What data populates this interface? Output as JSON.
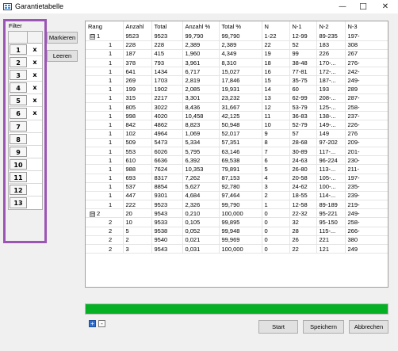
{
  "window": {
    "title": "Garantietabelle",
    "minimize": "—",
    "maximize": "☐",
    "close": "✕"
  },
  "filter": {
    "label": "Filter",
    "rows": [
      {
        "num": "1",
        "mark": "x"
      },
      {
        "num": "2",
        "mark": "x"
      },
      {
        "num": "3",
        "mark": "x"
      },
      {
        "num": "4",
        "mark": "x"
      },
      {
        "num": "5",
        "mark": "x"
      },
      {
        "num": "6",
        "mark": "x"
      },
      {
        "num": "7",
        "mark": ""
      },
      {
        "num": "8",
        "mark": ""
      },
      {
        "num": "9",
        "mark": ""
      },
      {
        "num": "10",
        "mark": ""
      },
      {
        "num": "11",
        "mark": ""
      },
      {
        "num": "12",
        "mark": ""
      },
      {
        "num": "13",
        "mark": ""
      }
    ]
  },
  "buttons": {
    "markieren": "Markieren",
    "leeren": "Leeren",
    "start": "Start",
    "speichern": "Speichern",
    "abbrechen": "Abbrechen",
    "plus": "+",
    "minus": "-"
  },
  "table": {
    "columns": [
      "Rang",
      "Anzahl",
      "Total",
      "Anzahl %",
      "Total %",
      "N",
      "N-1",
      "N-2",
      "N-3"
    ],
    "rows": [
      {
        "level": 0,
        "toggle": "⊟",
        "rang": "1",
        "anzahl": "9523",
        "total": "9523",
        "anzp": "99,790",
        "totp": "99,790",
        "n": "1-22",
        "n1": "12-99",
        "n2": "89-235",
        "n3": "197-"
      },
      {
        "level": 1,
        "rang": "1",
        "anzahl": "228",
        "total": "228",
        "anzp": "2,389",
        "totp": "2,389",
        "n": "22",
        "n1": "52",
        "n2": "183",
        "n3": "308"
      },
      {
        "level": 1,
        "rang": "1",
        "anzahl": "187",
        "total": "415",
        "anzp": "1,960",
        "totp": "4,349",
        "n": "19",
        "n1": "99",
        "n2": "226",
        "n3": "267"
      },
      {
        "level": 1,
        "rang": "1",
        "anzahl": "378",
        "total": "793",
        "anzp": "3,961",
        "totp": "8,310",
        "n": "18",
        "n1": "38-48",
        "n2": "170-...",
        "n3": "276-"
      },
      {
        "level": 1,
        "rang": "1",
        "anzahl": "641",
        "total": "1434",
        "anzp": "6,717",
        "totp": "15,027",
        "n": "16",
        "n1": "77-81",
        "n2": "172-...",
        "n3": "242-"
      },
      {
        "level": 1,
        "rang": "1",
        "anzahl": "269",
        "total": "1703",
        "anzp": "2,819",
        "totp": "17,846",
        "n": "15",
        "n1": "35-75",
        "n2": "187-...",
        "n3": "249-"
      },
      {
        "level": 1,
        "rang": "1",
        "anzahl": "199",
        "total": "1902",
        "anzp": "2,085",
        "totp": "19,931",
        "n": "14",
        "n1": "60",
        "n2": "193",
        "n3": "289"
      },
      {
        "level": 1,
        "rang": "1",
        "anzahl": "315",
        "total": "2217",
        "anzp": "3,301",
        "totp": "23,232",
        "n": "13",
        "n1": "62-99",
        "n2": "208-...",
        "n3": "287-"
      },
      {
        "level": 1,
        "rang": "1",
        "anzahl": "805",
        "total": "3022",
        "anzp": "8,436",
        "totp": "31,667",
        "n": "12",
        "n1": "53-79",
        "n2": "125-...",
        "n3": "258-"
      },
      {
        "level": 1,
        "rang": "1",
        "anzahl": "998",
        "total": "4020",
        "anzp": "10,458",
        "totp": "42,125",
        "n": "11",
        "n1": "36-83",
        "n2": "138-...",
        "n3": "237-"
      },
      {
        "level": 1,
        "rang": "1",
        "anzahl": "842",
        "total": "4862",
        "anzp": "8,823",
        "totp": "50,948",
        "n": "10",
        "n1": "52-79",
        "n2": "149-...",
        "n3": "226-"
      },
      {
        "level": 1,
        "rang": "1",
        "anzahl": "102",
        "total": "4964",
        "anzp": "1,069",
        "totp": "52,017",
        "n": "9",
        "n1": "57",
        "n2": "149",
        "n3": "276"
      },
      {
        "level": 1,
        "rang": "1",
        "anzahl": "509",
        "total": "5473",
        "anzp": "5,334",
        "totp": "57,351",
        "n": "8",
        "n1": "28-68",
        "n2": "97-202",
        "n3": "209-"
      },
      {
        "level": 1,
        "rang": "1",
        "anzahl": "553",
        "total": "6026",
        "anzp": "5,795",
        "totp": "63,146",
        "n": "7",
        "n1": "30-89",
        "n2": "117-...",
        "n3": "201-"
      },
      {
        "level": 1,
        "rang": "1",
        "anzahl": "610",
        "total": "6636",
        "anzp": "6,392",
        "totp": "69,538",
        "n": "6",
        "n1": "24-63",
        "n2": "96-224",
        "n3": "230-"
      },
      {
        "level": 1,
        "rang": "1",
        "anzahl": "988",
        "total": "7624",
        "anzp": "10,353",
        "totp": "79,891",
        "n": "5",
        "n1": "26-80",
        "n2": "113-...",
        "n3": "211-"
      },
      {
        "level": 1,
        "rang": "1",
        "anzahl": "693",
        "total": "8317",
        "anzp": "7,262",
        "totp": "87,153",
        "n": "4",
        "n1": "20-58",
        "n2": "105-...",
        "n3": "197-"
      },
      {
        "level": 1,
        "rang": "1",
        "anzahl": "537",
        "total": "8854",
        "anzp": "5,627",
        "totp": "92,780",
        "n": "3",
        "n1": "24-62",
        "n2": "100-...",
        "n3": "235-"
      },
      {
        "level": 1,
        "rang": "1",
        "anzahl": "447",
        "total": "9301",
        "anzp": "4,684",
        "totp": "97,464",
        "n": "2",
        "n1": "18-55",
        "n2": "114-...",
        "n3": "239-"
      },
      {
        "level": 1,
        "rang": "1",
        "anzahl": "222",
        "total": "9523",
        "anzp": "2,326",
        "totp": "99,790",
        "n": "1",
        "n1": "12-58",
        "n2": "89-189",
        "n3": "219-"
      },
      {
        "level": 0,
        "toggle": "⊟",
        "rang": "2",
        "anzahl": "20",
        "total": "9543",
        "anzp": "0,210",
        "totp": "100,000",
        "n": "0",
        "n1": "22-32",
        "n2": "95-221",
        "n3": "249-"
      },
      {
        "level": 1,
        "rang": "2",
        "anzahl": "10",
        "total": "9533",
        "anzp": "0,105",
        "totp": "99,895",
        "n": "0",
        "n1": "32",
        "n2": "95-150",
        "n3": "258-"
      },
      {
        "level": 1,
        "rang": "2",
        "anzahl": "5",
        "total": "9538",
        "anzp": "0,052",
        "totp": "99,948",
        "n": "0",
        "n1": "28",
        "n2": "115-...",
        "n3": "266-"
      },
      {
        "level": 1,
        "rang": "2",
        "anzahl": "2",
        "total": "9540",
        "anzp": "0,021",
        "totp": "99,969",
        "n": "0",
        "n1": "26",
        "n2": "221",
        "n3": "380"
      },
      {
        "level": 1,
        "rang": "2",
        "anzahl": "3",
        "total": "9543",
        "anzp": "0,031",
        "totp": "100,000",
        "n": "0",
        "n1": "22",
        "n2": "121",
        "n3": "249"
      }
    ]
  },
  "progress": {
    "percent": 100,
    "color": "#06b025"
  }
}
